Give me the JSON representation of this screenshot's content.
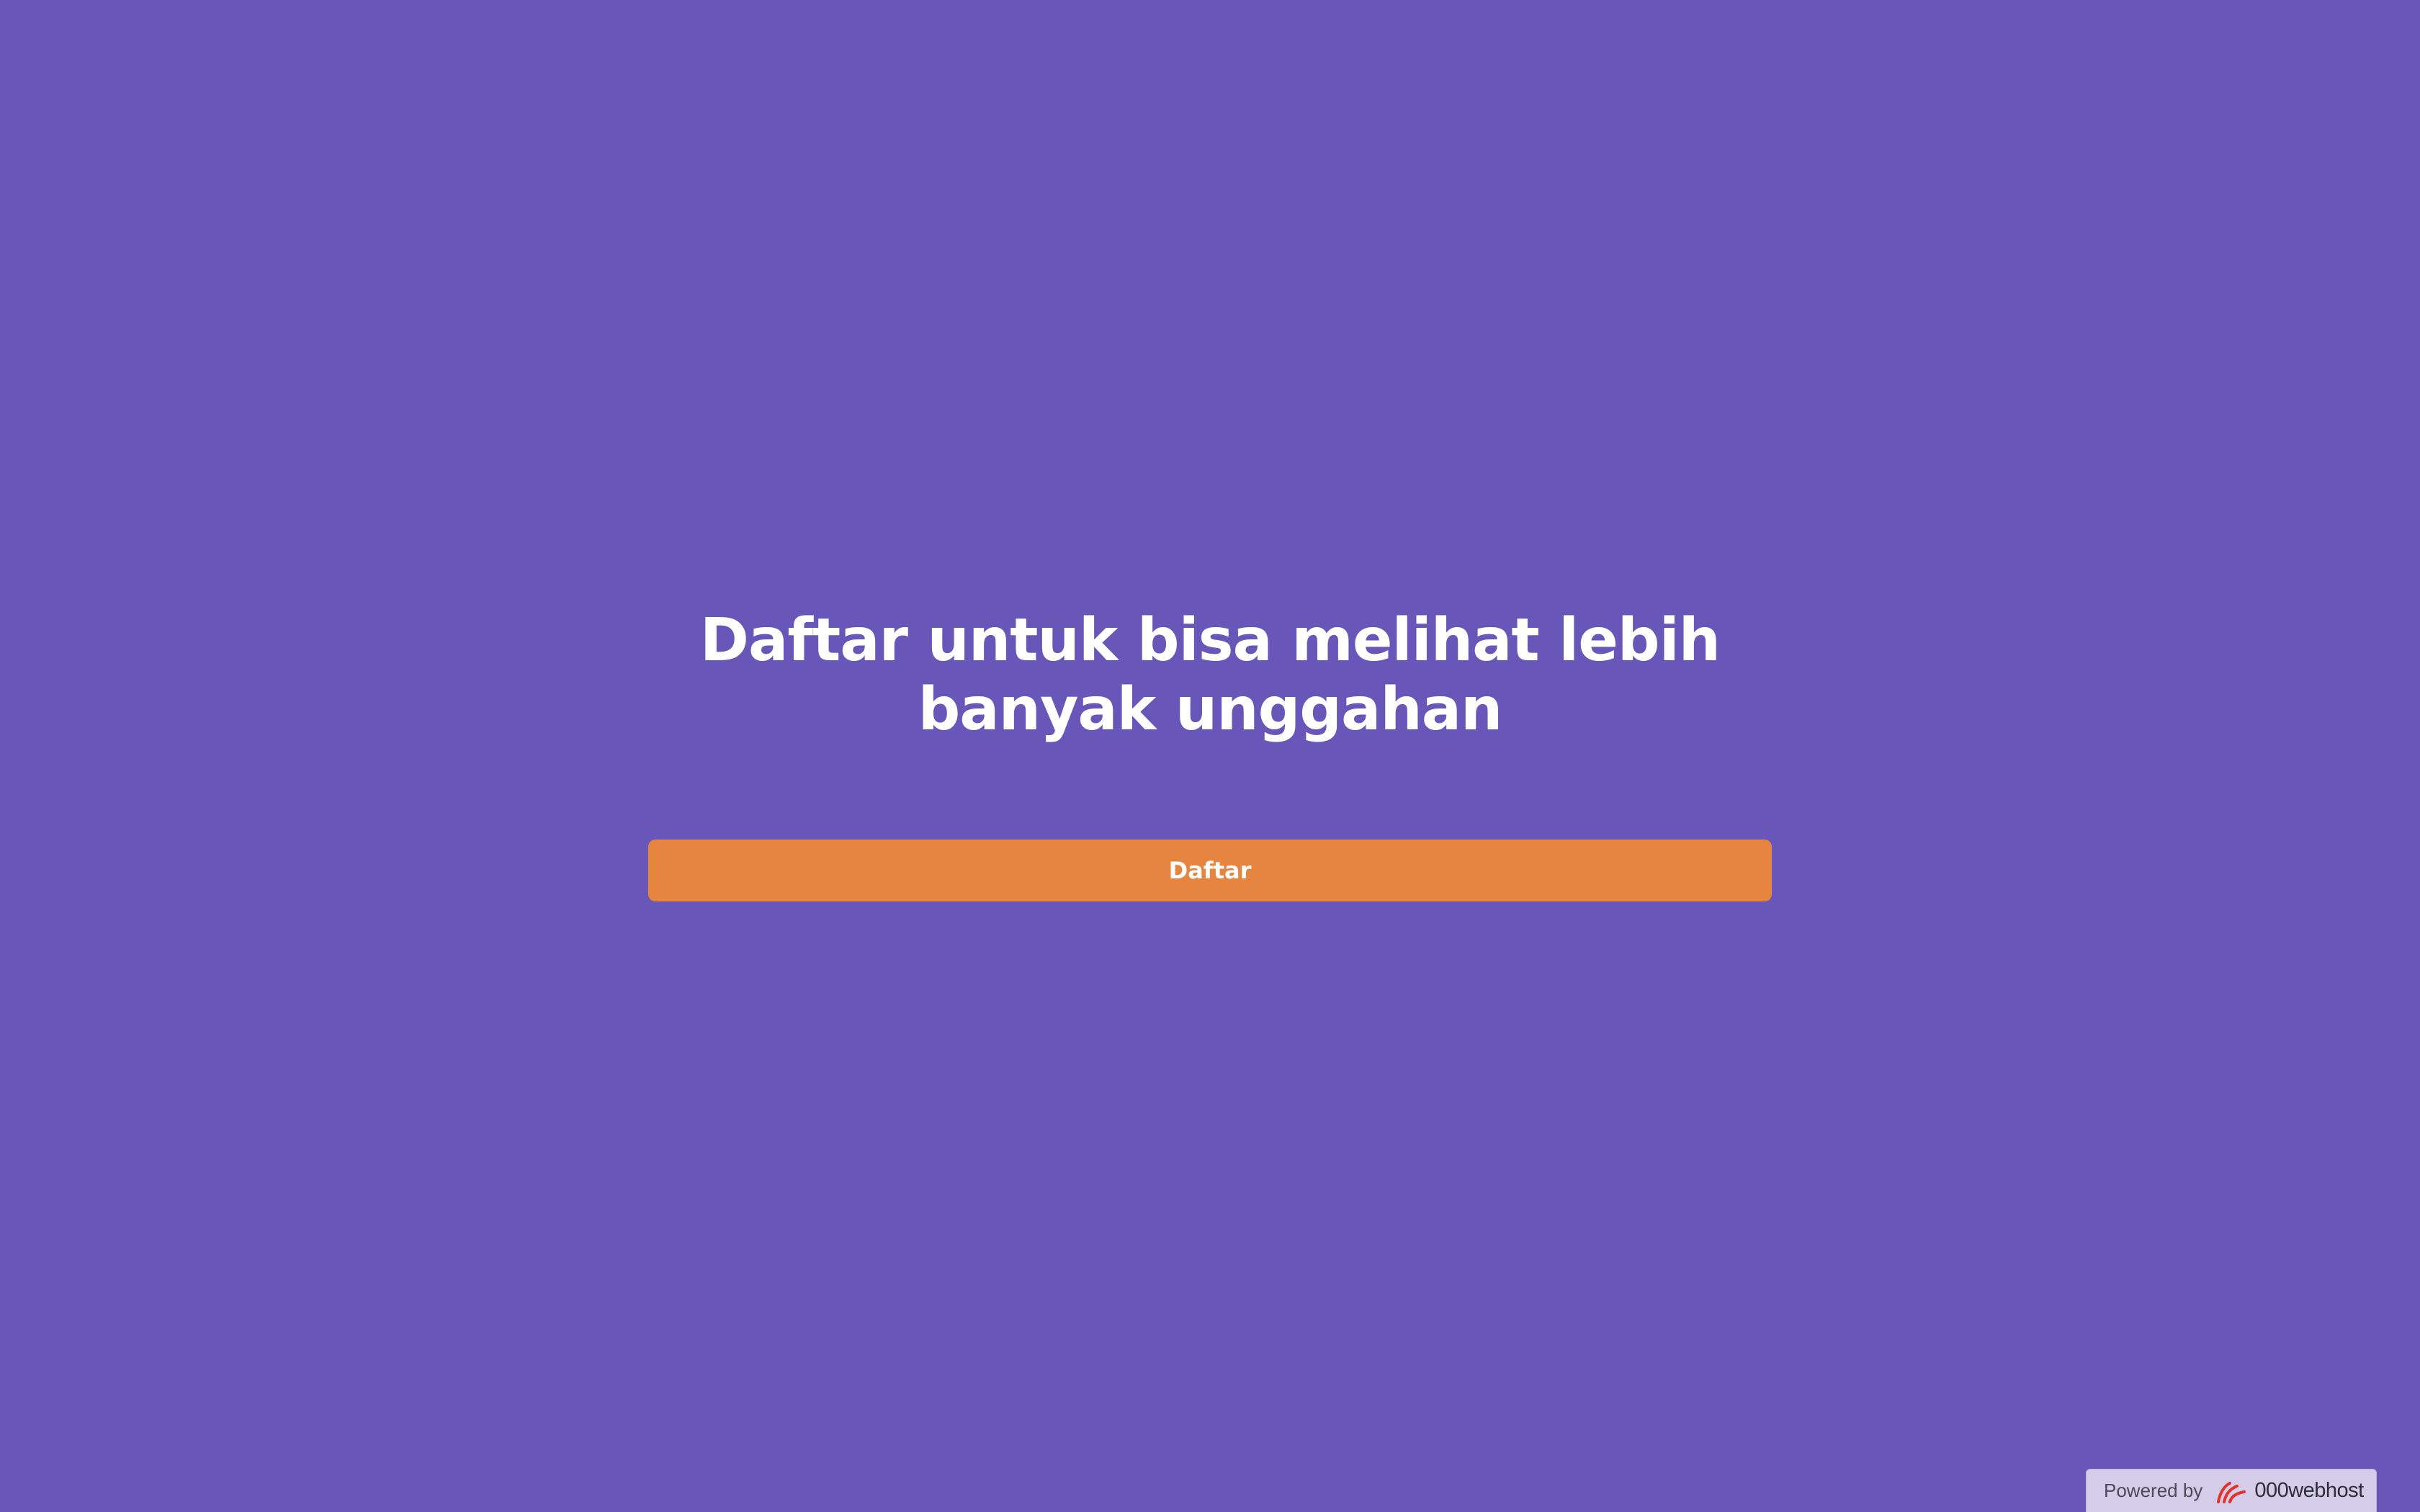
{
  "main": {
    "headline_line1": "Daftar untuk bisa melihat lebih",
    "headline_line2": "banyak unggahan",
    "cta_label": "Daftar"
  },
  "footer_badge": {
    "prefix": "Powered by",
    "brand": "000webhost",
    "icon": "000webhost-logo-icon"
  },
  "colors": {
    "background": "#6856b8",
    "cta": "#e68540",
    "text": "#ffffff",
    "badge_bg": "#d4cce8",
    "brand_accent": "#e0342a"
  }
}
